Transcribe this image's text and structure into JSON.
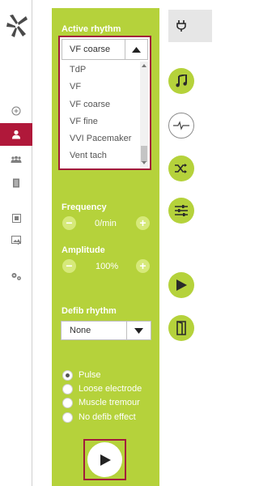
{
  "active_rhythm": {
    "label": "Active rhythm",
    "selected": "VF coarse",
    "options": [
      "TdP",
      "VF",
      "VF coarse",
      "VF fine",
      "VVI Pacemaker",
      "Vent tach"
    ]
  },
  "frequency": {
    "label": "Frequency",
    "value": "0/min",
    "minus": "−",
    "plus": "+"
  },
  "amplitude": {
    "label": "Amplitude",
    "value": "100%",
    "minus": "−",
    "plus": "+"
  },
  "defib_rhythm": {
    "label": "Defib rhythm",
    "selected": "None"
  },
  "defib_effect": {
    "options": [
      {
        "label": "Pulse",
        "selected": true
      },
      {
        "label": "Loose electrode",
        "selected": false
      },
      {
        "label": "Muscle tremour",
        "selected": false
      },
      {
        "label": "No defib effect",
        "selected": false
      }
    ]
  },
  "colors": {
    "panel": "#b5d23b",
    "accent": "#b0183a",
    "frame": "#a21b3c"
  },
  "icons": {
    "rail": [
      "add-circle-icon",
      "user-icon",
      "group-icon",
      "document-icon",
      "image-icon",
      "image-edit-icon",
      "settings-icon"
    ],
    "right": [
      "plug-icon",
      "music-note-icon",
      "heartbeat-icon",
      "shuffle-icon",
      "sliders-icon",
      "play-icon",
      "door-icon"
    ]
  }
}
